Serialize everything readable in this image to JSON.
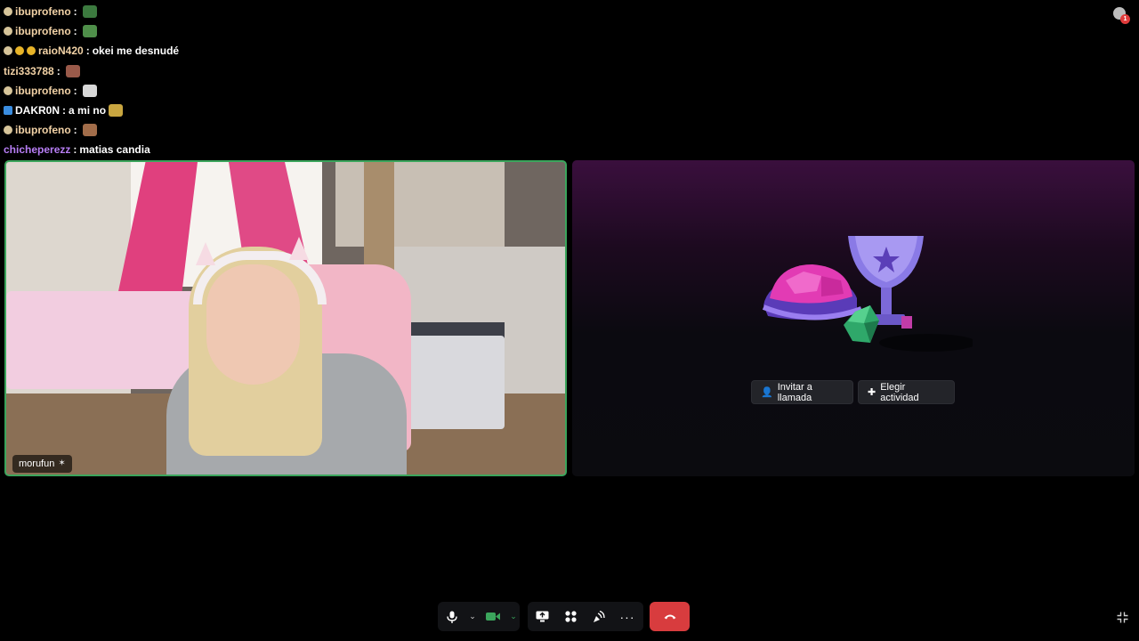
{
  "chat": {
    "messages": [
      {
        "user": "ibuprofeno",
        "text": "",
        "user_color": "#f2d2a6",
        "badges": [
          "#d7c59a"
        ],
        "emote": "#3c7a3f"
      },
      {
        "user": "ibuprofeno",
        "text": "",
        "user_color": "#f2d2a6",
        "badges": [
          "#d7c59a"
        ],
        "emote": "#4f8f4a"
      },
      {
        "user": "raioN420",
        "text": "okei me desnudé",
        "user_color": "#f2d2a6",
        "badges": [
          "#d7c59a",
          "#e8b428",
          "#e8b428"
        ],
        "emote": ""
      },
      {
        "user": "tizi333788",
        "text": "",
        "user_color": "#f2d2a6",
        "badges": [],
        "emote": "#9a5a4a"
      },
      {
        "user": "ibuprofeno",
        "text": "",
        "user_color": "#f2d2a6",
        "badges": [
          "#d7c59a"
        ],
        "emote": "#d8d8d8"
      },
      {
        "user": "DAKR0N",
        "text": "a mi no",
        "user_color": "#ffffff",
        "badges": [
          "#3a8de0"
        ],
        "emote": "#c9a640"
      },
      {
        "user": "ibuprofeno",
        "text": "",
        "user_color": "#f2d2a6",
        "badges": [
          "#d7c59a"
        ],
        "emote": "#a26d4a"
      },
      {
        "user": "chicheperezz",
        "text": "matias candia",
        "user_color": "#b77ef5",
        "badges": [],
        "emote": ""
      }
    ],
    "separator": ":"
  },
  "notifications": {
    "count": "1"
  },
  "participant": {
    "name": "morufun",
    "status_icon": "streaming-icon"
  },
  "activity": {
    "invite_label": "Invitar a llamada",
    "choose_label": "Elegir actividad"
  },
  "colors": {
    "speaking_border": "#3ba55c",
    "hangup": "#d83c3e",
    "camera_on": "#3ba55c"
  }
}
